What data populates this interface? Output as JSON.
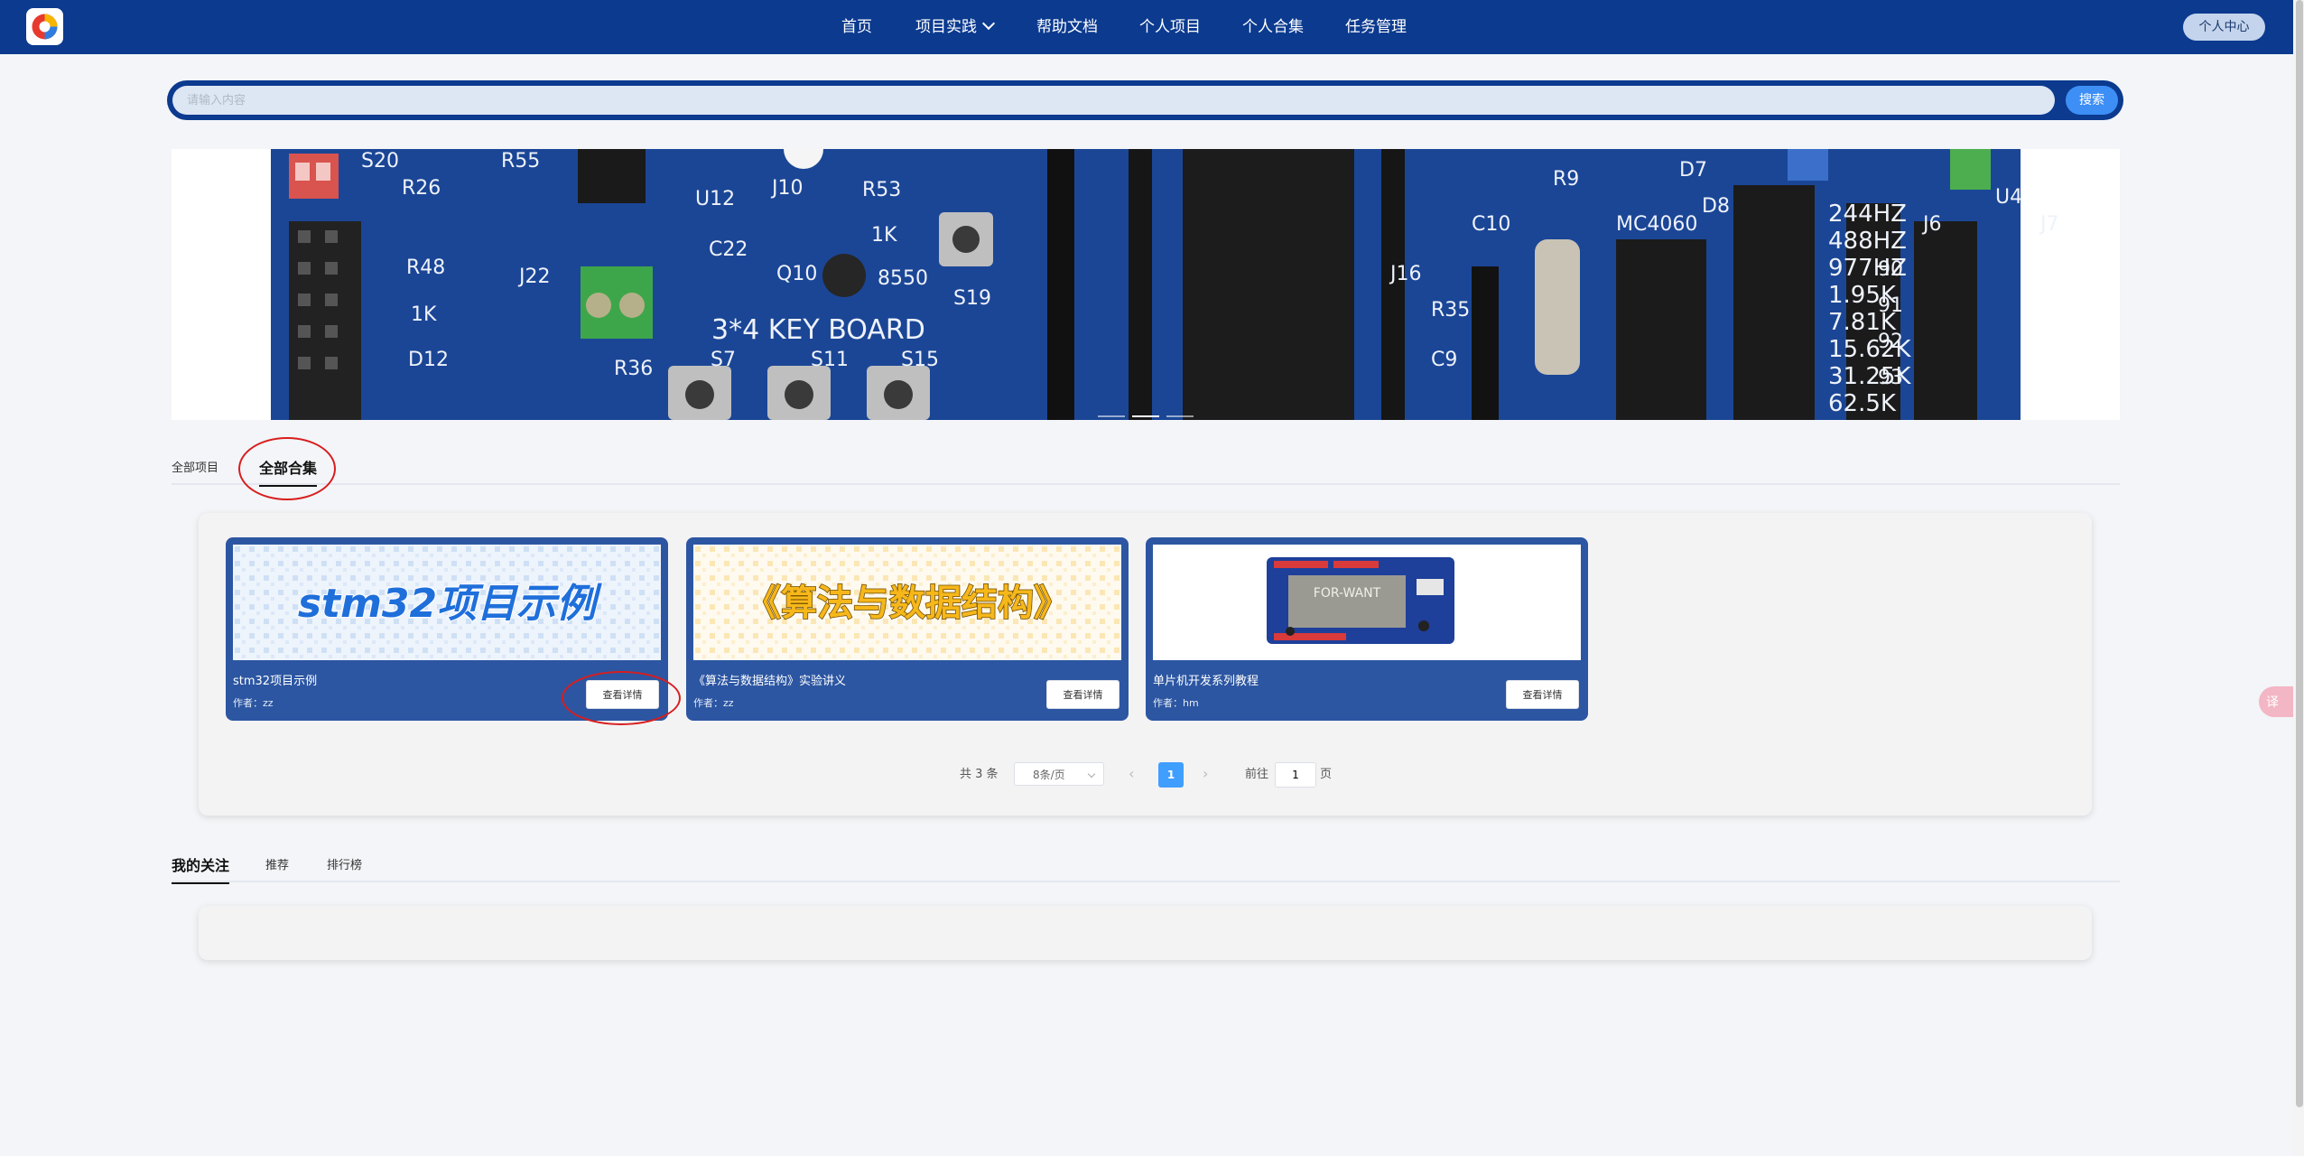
{
  "nav": {
    "items": [
      "首页",
      "项目实践",
      "帮助文档",
      "个人项目",
      "个人合集",
      "任务管理"
    ],
    "user_button": "个人中心"
  },
  "search": {
    "placeholder": "请输入内容",
    "button": "搜索"
  },
  "banner": {
    "silkscreen": [
      "S20",
      "R26",
      "R55",
      "U12",
      "J10",
      "R53",
      "1K",
      "R48",
      "1K",
      "J22",
      "C22",
      "Q10",
      "8550",
      "S19",
      "3*4 KEY BOARD",
      "D12",
      "R36",
      "S7",
      "S11",
      "S15",
      "J16",
      "R35",
      "C9",
      "C10",
      "R9",
      "MC4060",
      "244HZ",
      "488HZ",
      "977HZ",
      "1.95K",
      "7.81K",
      "15.62K",
      "31.25K",
      "62.5K",
      "J6",
      "J7",
      "U4",
      "D7",
      "D8",
      "90",
      "91",
      "92",
      "93"
    ],
    "slide_count": 3
  },
  "tabs_top": {
    "items": [
      "全部项目",
      "全部合集"
    ],
    "active": "全部合集"
  },
  "cards": [
    {
      "image_text": "stm32项目示例",
      "title": "stm32项目示例",
      "author": "作者：zz",
      "button": "查看详情"
    },
    {
      "image_text": "《算法与数据结构》",
      "title": "《算法与数据结构》实验讲义",
      "author": "作者：zz",
      "button": "查看详情"
    },
    {
      "image_text": "FOR-WANT",
      "title": "单片机开发系列教程",
      "author": "作者：hm",
      "button": "查看详情"
    }
  ],
  "pagination": {
    "total": "共 3 条",
    "page_size": "8条/页",
    "current": "1",
    "goto_label": "前往",
    "goto_value": "1",
    "page_unit": "页"
  },
  "tabs_bottom": {
    "items": [
      "我的关注",
      "推荐",
      "排行榜"
    ],
    "active": "我的关注"
  },
  "side_float": {
    "label": "译"
  },
  "colors": {
    "nav": "#0b3a8f",
    "card": "#2c56a2",
    "accent": "#409eff",
    "annotation": "#d81e1e"
  }
}
